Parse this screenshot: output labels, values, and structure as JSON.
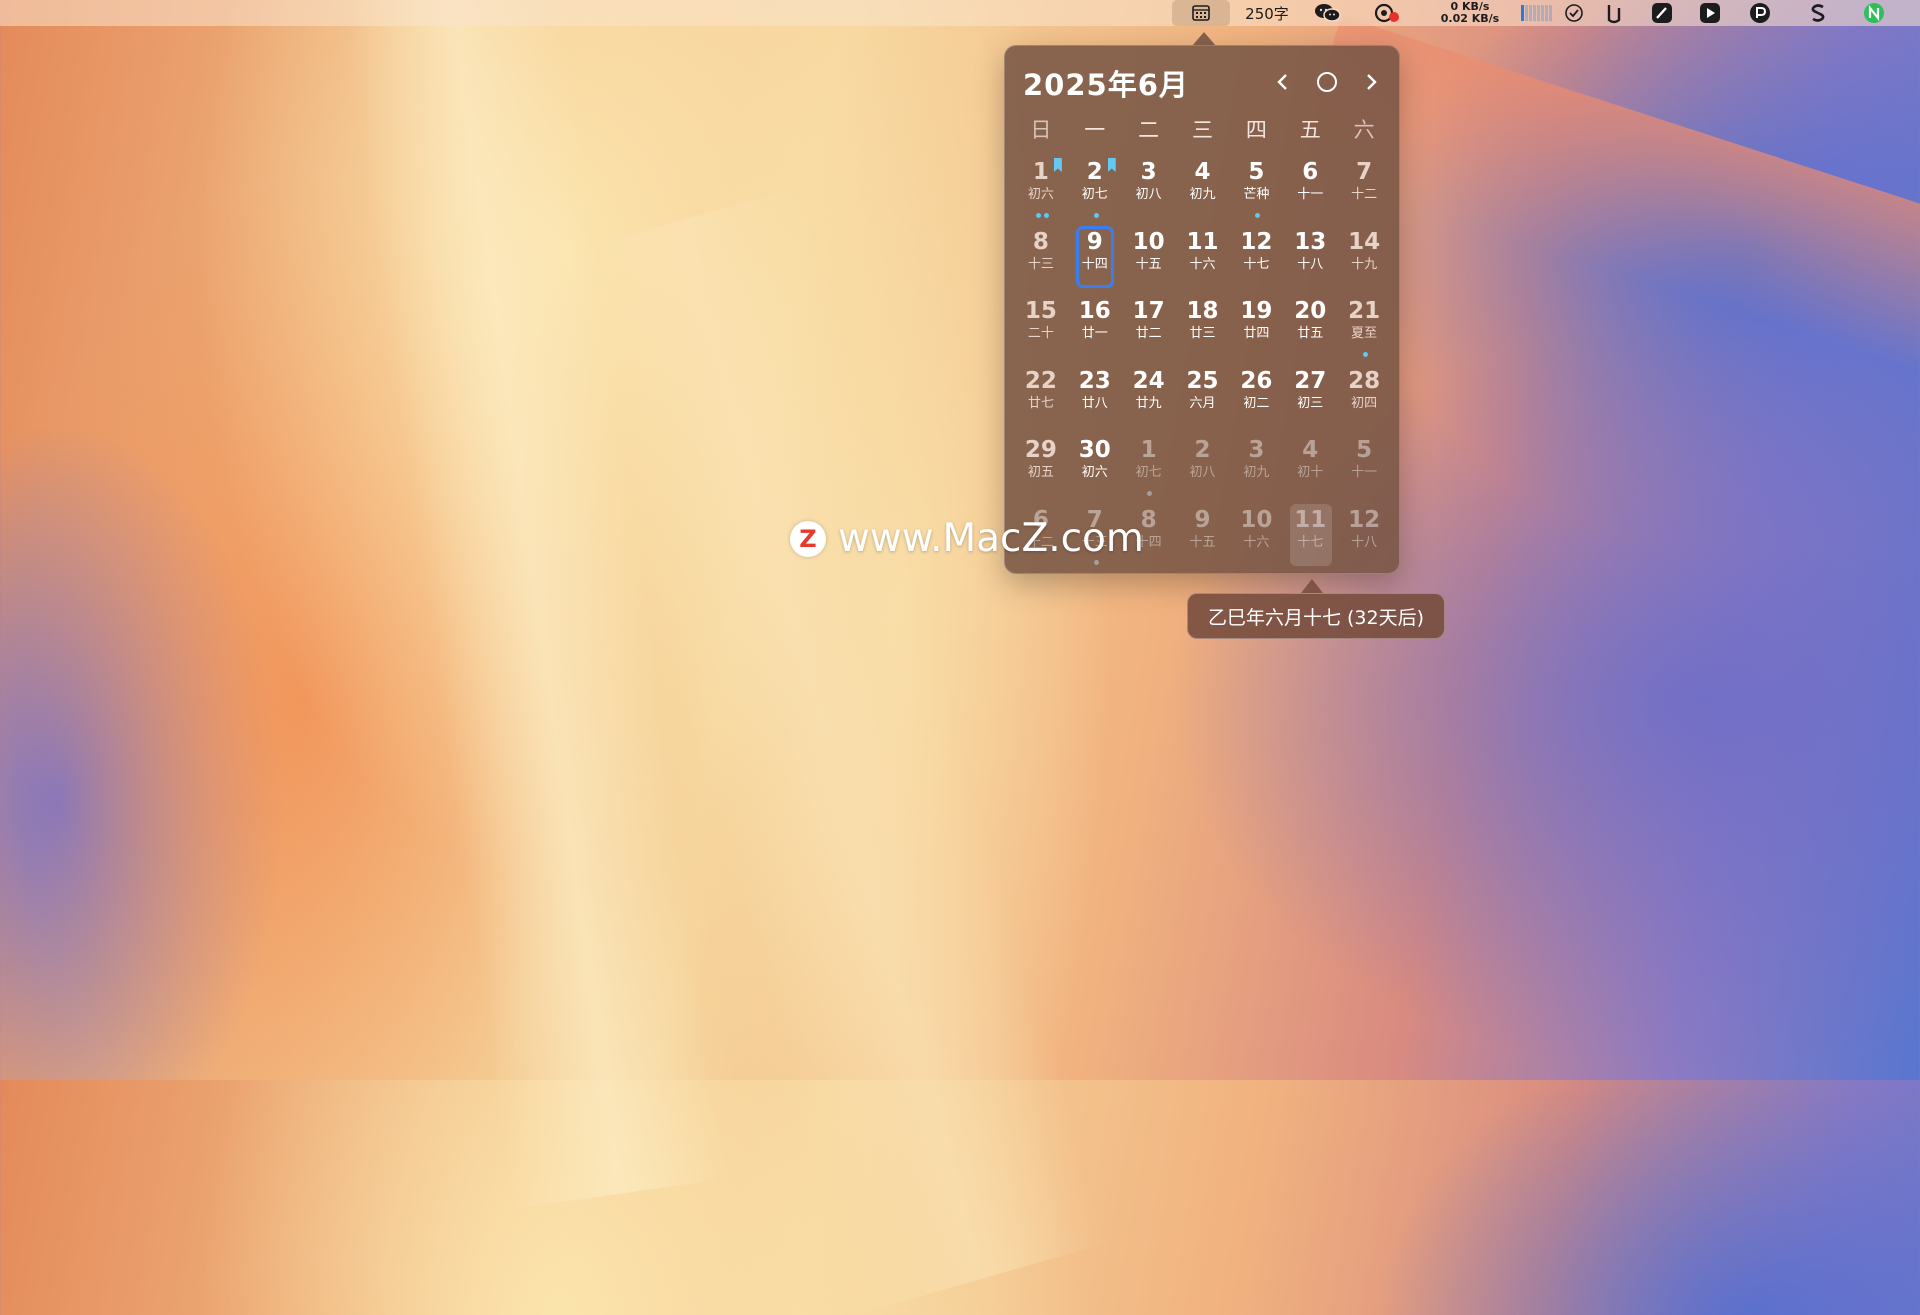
{
  "menubar": {
    "word_count": "250字",
    "net_up": "0 KB/s",
    "net_down": "0.02 KB/s"
  },
  "calendar": {
    "title": "2025年6月",
    "weekdays": [
      "日",
      "一",
      "二",
      "三",
      "四",
      "五",
      "六"
    ],
    "weeks": [
      [
        {
          "d": "1",
          "l": "初六",
          "weekend": true,
          "dots": 2,
          "bookmark": true
        },
        {
          "d": "2",
          "l": "初七",
          "dots": 1,
          "bookmark": true
        },
        {
          "d": "3",
          "l": "初八"
        },
        {
          "d": "4",
          "l": "初九"
        },
        {
          "d": "5",
          "l": "芒种",
          "dots": 1
        },
        {
          "d": "6",
          "l": "十一"
        },
        {
          "d": "7",
          "l": "十二",
          "weekend": true
        }
      ],
      [
        {
          "d": "8",
          "l": "十三",
          "weekend": true
        },
        {
          "d": "9",
          "l": "十四",
          "today": true
        },
        {
          "d": "10",
          "l": "十五"
        },
        {
          "d": "11",
          "l": "十六"
        },
        {
          "d": "12",
          "l": "十七"
        },
        {
          "d": "13",
          "l": "十八"
        },
        {
          "d": "14",
          "l": "十九",
          "weekend": true
        }
      ],
      [
        {
          "d": "15",
          "l": "二十",
          "weekend": true
        },
        {
          "d": "16",
          "l": "廿一"
        },
        {
          "d": "17",
          "l": "廿二"
        },
        {
          "d": "18",
          "l": "廿三"
        },
        {
          "d": "19",
          "l": "廿四"
        },
        {
          "d": "20",
          "l": "廿五"
        },
        {
          "d": "21",
          "l": "夏至",
          "weekend": true,
          "dots": 1
        }
      ],
      [
        {
          "d": "22",
          "l": "廿七",
          "weekend": true
        },
        {
          "d": "23",
          "l": "廿八"
        },
        {
          "d": "24",
          "l": "廿九"
        },
        {
          "d": "25",
          "l": "六月"
        },
        {
          "d": "26",
          "l": "初二"
        },
        {
          "d": "27",
          "l": "初三"
        },
        {
          "d": "28",
          "l": "初四",
          "weekend": true
        }
      ],
      [
        {
          "d": "29",
          "l": "初五",
          "weekend": true
        },
        {
          "d": "30",
          "l": "初六"
        },
        {
          "d": "1",
          "l": "初七",
          "other": true,
          "dots": 1
        },
        {
          "d": "2",
          "l": "初八",
          "other": true
        },
        {
          "d": "3",
          "l": "初九",
          "other": true
        },
        {
          "d": "4",
          "l": "初十",
          "other": true
        },
        {
          "d": "5",
          "l": "十一",
          "other": true
        }
      ],
      [
        {
          "d": "6",
          "l": "十二",
          "other": true
        },
        {
          "d": "7",
          "l": "十三",
          "other": true,
          "dots": 1
        },
        {
          "d": "8",
          "l": "十四",
          "other": true
        },
        {
          "d": "9",
          "l": "十五",
          "other": true
        },
        {
          "d": "10",
          "l": "十六",
          "other": true
        },
        {
          "d": "11",
          "l": "十七",
          "other": true,
          "hover": true
        },
        {
          "d": "12",
          "l": "十八",
          "other": true
        }
      ]
    ],
    "tooltip": "乙巳年六月十七 (32天后)"
  },
  "colors": {
    "event_dot": "#5ec8f0",
    "today_ring": "#3a7ff0"
  },
  "watermark": {
    "logo": "Z",
    "text": "www.MacZ.com"
  }
}
